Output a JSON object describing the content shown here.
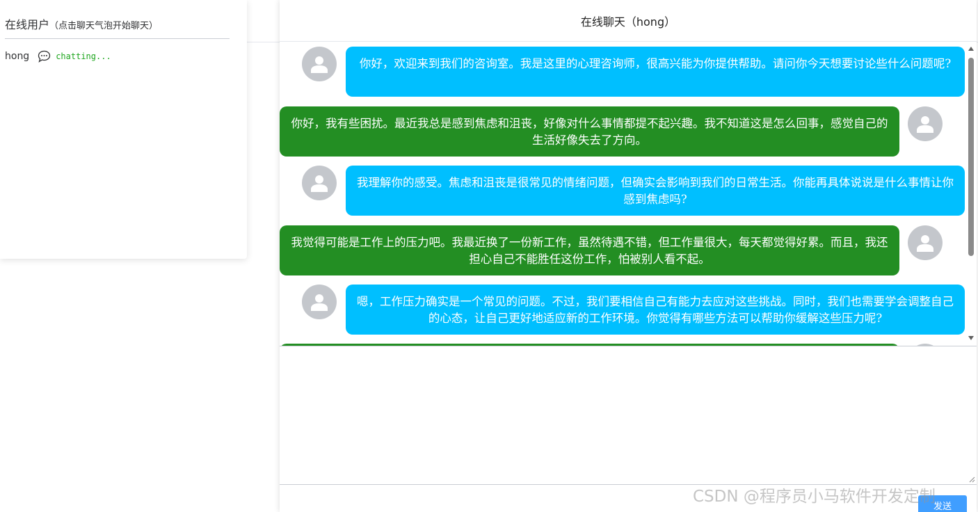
{
  "users_panel": {
    "title": "在线用户",
    "hint": "（点击聊天气泡开始聊天）",
    "users": [
      {
        "name": "hong",
        "status": "chatting...",
        "icon": "chat-bubble-icon"
      }
    ]
  },
  "chat": {
    "title": "在线聊天（hong）",
    "messages": [
      {
        "side": "left",
        "text": "你好，欢迎来到我们的咨询室。我是这里的心理咨询师，很高兴能为你提供帮助。请问你今天想要讨论些什么问题呢?"
      },
      {
        "side": "right",
        "text": "你好，我有些困扰。最近我总是感到焦虑和沮丧，好像对什么事情都提不起兴趣。我不知道这是怎么回事，感觉自己的生活好像失去了方向。"
      },
      {
        "side": "left",
        "text": "我理解你的感受。焦虑和沮丧是很常见的情绪问题，但确实会影响到我们的日常生活。你能再具体说说是什么事情让你感到焦虑吗?"
      },
      {
        "side": "right",
        "text": "我觉得可能是工作上的压力吧。我最近换了一份新工作，虽然待遇不错，但工作量很大，每天都觉得好累。而且，我还担心自己不能胜任这份工作，怕被别人看不起。"
      },
      {
        "side": "left",
        "text": "嗯，工作压力确实是一个常见的问题。不过，我们要相信自己有能力去应对这些挑战。同时，我们也需要学会调整自己的心态，让自己更好地适应新的工作环境。你觉得有哪些方法可以帮助你缓解这些压力呢?"
      },
      {
        "side": "right",
        "text": ""
      }
    ],
    "input_value": "",
    "send_label": "发送"
  },
  "colors": {
    "counselor_bubble": "#00bfff",
    "user_bubble": "#238e23",
    "status_green": "#1fa61f",
    "send_button": "#409eff",
    "avatar_bg": "#c4c7cc"
  },
  "watermark": "CSDN @程序员小马软件开发定制"
}
